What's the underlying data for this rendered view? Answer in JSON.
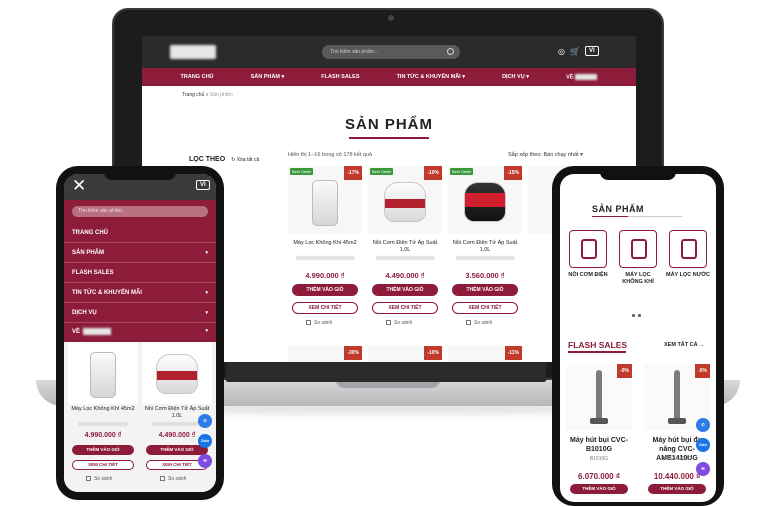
{
  "desktop": {
    "search_placeholder": "Tìm kiếm sản phẩm...",
    "lang": "VI",
    "nav": [
      "TRANG CHỦ",
      "SẢN PHẨM",
      "FLASH SALES",
      "TIN TỨC & KHUYẾN MÃI",
      "DỊCH VỤ",
      "VỀ"
    ],
    "breadcrumb": {
      "home": "Trang chủ",
      "sep": "»",
      "current": "Sản phẩm"
    },
    "page_title": "SẢN PHẨM",
    "filter": {
      "title": "LỌC THEO",
      "clear": "Xóa tất cả"
    },
    "result_count": "Hiển thị 1–16 trong số 178 kết quả",
    "sort": "Sắp xếp theo: Bán chạy nhất",
    "products": [
      {
        "best": "Best Seller",
        "off": "-17%",
        "name": "Máy Lọc Không Khí 45m2",
        "price": "4.990.000 ₫"
      },
      {
        "best": "Best Seller",
        "off": "-10%",
        "name": "Nồi Cơm Điện Tử Áp Suất 1.0L",
        "price": "4.490.000 ₫"
      },
      {
        "best": "Best Seller",
        "off": "-15%",
        "name": "Nồi Cơm Điện Tử Áp Suất 1.0L",
        "price": "3.560.000 ₫"
      }
    ],
    "second_row_offs": [
      "-30%",
      "-10%",
      "-11%"
    ],
    "add_label": "THÊM VÀO GIỎ",
    "detail_label": "XEM CHI TIẾT",
    "compare_label": "So sánh"
  },
  "phone_left": {
    "search_placeholder": "Tìm kiếm sản phẩm...",
    "lang": "VI",
    "menu": [
      "TRANG CHỦ",
      "SẢN PHẨM",
      "FLASH SALES",
      "TIN TỨC & KHUYẾN MÃI",
      "DỊCH VỤ",
      "VỀ"
    ],
    "cards": [
      {
        "name": "Máy Lọc Không Khí 45m2",
        "price": "4.990.000 ₫"
      },
      {
        "name": "Nồi Cơm Điện Tử Áp Suất 1.0L",
        "price": "4.490.000 ₫"
      }
    ],
    "add_label": "THÊM VÀO GIỎ",
    "detail_label": "XEM CHI TIẾT",
    "compare_label": "So sánh",
    "zalo": "Zalo"
  },
  "phone_right": {
    "title": "SẢN PHẨM",
    "categories": [
      "NỒI CƠM ĐIỆN",
      "MÁY LỌC KHÔNG KHÍ",
      "MÁY LỌC NƯỚC"
    ],
    "flash_title": "FLASH SALES",
    "see_all": "XEM TẤT CẢ",
    "flash_cards": [
      {
        "off": "-0%",
        "name": "Máy hút bụi CVC-B1010G",
        "code": "B1010G",
        "price": "6.070.000 ₫"
      },
      {
        "off": "-0%",
        "name": "Máy hút bụi đa năng CVC-AME1410UG",
        "code": "UME1410UG",
        "price": "10.440.000 ₫"
      }
    ],
    "add_label": "THÊM VÀO GIỎ",
    "zalo": "Zalo"
  },
  "colors": {
    "brand": "#8c1c3a",
    "best_seller": "#3a9a3a",
    "discount": "#c0392b"
  }
}
